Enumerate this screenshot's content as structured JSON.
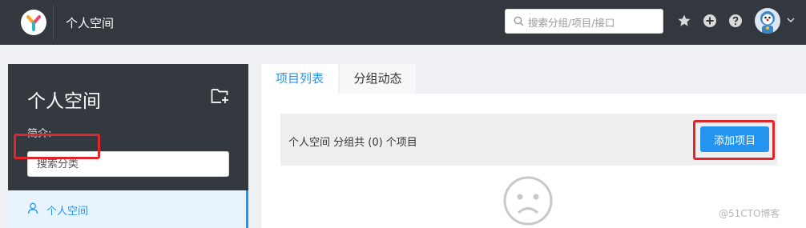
{
  "header": {
    "title": "个人空间",
    "search_placeholder": "搜索分组/项目/接口"
  },
  "sidebar": {
    "title": "个人空间",
    "intro_label": "简介:",
    "search_placeholder": "搜索分类",
    "items": [
      {
        "label": "个人空间",
        "icon": "user-icon",
        "active": true
      }
    ]
  },
  "tabs": [
    {
      "label": "项目列表",
      "active": true
    },
    {
      "label": "分组动态",
      "active": false
    }
  ],
  "main": {
    "summary": "个人空间 分组共 (0) 个项目",
    "add_button": "添加项目",
    "empty_icon": "sad-face-icon"
  },
  "watermark": "@51CTO博客",
  "colors": {
    "header_bg": "#33383f",
    "sidebar_bg": "#34393f",
    "accent": "#2395f1",
    "highlight": "#e0252d"
  }
}
